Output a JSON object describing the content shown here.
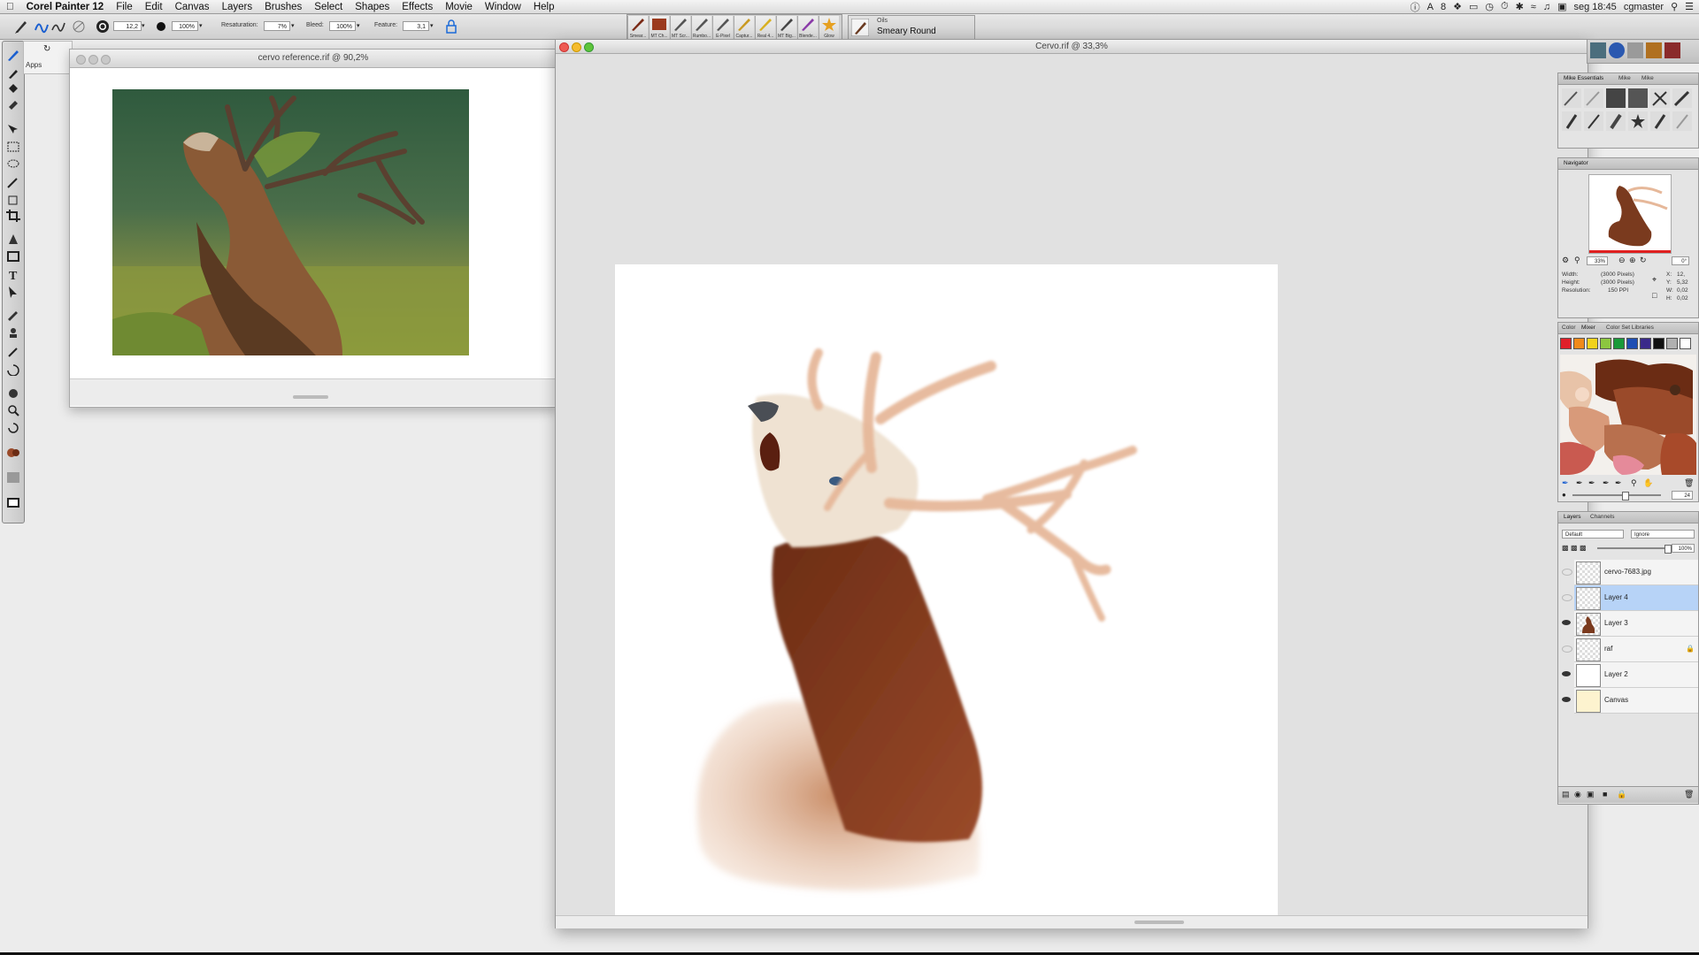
{
  "menubar": {
    "app_name": "Corel Painter 12",
    "items": [
      "File",
      "Edit",
      "Canvas",
      "Layers",
      "Brushes",
      "Select",
      "Shapes",
      "Effects",
      "Movie",
      "Window",
      "Help"
    ],
    "status_badge": "8",
    "clock": "seg 18:45",
    "user": "cgmaster"
  },
  "propbar": {
    "size_value": "12,2",
    "opacity_value": "100%",
    "resaturation_label": "Resaturation:",
    "resaturation_value": "7%",
    "bleed_label": "Bleed:",
    "bleed_value": "100%",
    "feature_label": "Feature:",
    "feature_value": "3,1"
  },
  "brush_tracker": [
    "Smear...",
    "MT Ch...",
    "MT Scr...",
    "Rumbo...",
    "E-Pixel",
    "Captur...",
    "Real 4...",
    "MT Big...",
    "Blende...",
    "Glow"
  ],
  "brush_category": "Oils",
  "brush_variant": "Smeary Round",
  "reference_window": {
    "title": "cervo reference.rif @ 90,2%",
    "behind_url_fragment": "Apps"
  },
  "main_window": {
    "title": "Cervo.rif @ 33,3%"
  },
  "brush_panel": {
    "tabs": [
      "Mike Essentials",
      "Mike",
      "Mike"
    ]
  },
  "navigator": {
    "title": "Navigator",
    "zoom": "33%",
    "rotation": "0°",
    "width_label": "Width:",
    "width_value": "(3000 Pixels)",
    "height_label": "Height:",
    "height_value": "(3000 Pixels)",
    "resolution_label": "Resolution:",
    "resolution_value": "150 PPI",
    "x_label": "X:",
    "x_value": "12,",
    "y_label": "Y:",
    "y_value": "5,32",
    "w_label": "W:",
    "w_value": "0,02",
    "h_label": "H:",
    "h_value": "0,02"
  },
  "color_panel": {
    "tabs": [
      "Color",
      "Mixer",
      "Color Set Libraries"
    ],
    "swatches": [
      "#e0202a",
      "#f08a1a",
      "#f2d21c",
      "#8cc63f",
      "#1a9a3a",
      "#1f4fb3",
      "#3a2a8a",
      "#111111",
      "#b0b0b0",
      "#ffffff"
    ],
    "mixer_value": "24"
  },
  "layers_panel": {
    "tabs": [
      "Layers",
      "Channels"
    ],
    "composite_method": "Default",
    "composite_depth": "Ignore",
    "opacity": "100%",
    "layers": [
      {
        "name": "cervo-7683.jpg",
        "visible": false,
        "selected": false
      },
      {
        "name": "Layer 4",
        "visible": false,
        "selected": true
      },
      {
        "name": "Layer 3",
        "visible": true,
        "selected": false
      },
      {
        "name": "raf",
        "visible": false,
        "selected": false
      },
      {
        "name": "Layer 2",
        "visible": true,
        "selected": false
      },
      {
        "name": "Canvas",
        "visible": true,
        "selected": false
      }
    ]
  },
  "colors": {
    "selection_blue": "#b7d3f7",
    "fur_dark": "#6b2c14",
    "fur_mid": "#9a4a2a",
    "antler": "#e6b89a"
  }
}
